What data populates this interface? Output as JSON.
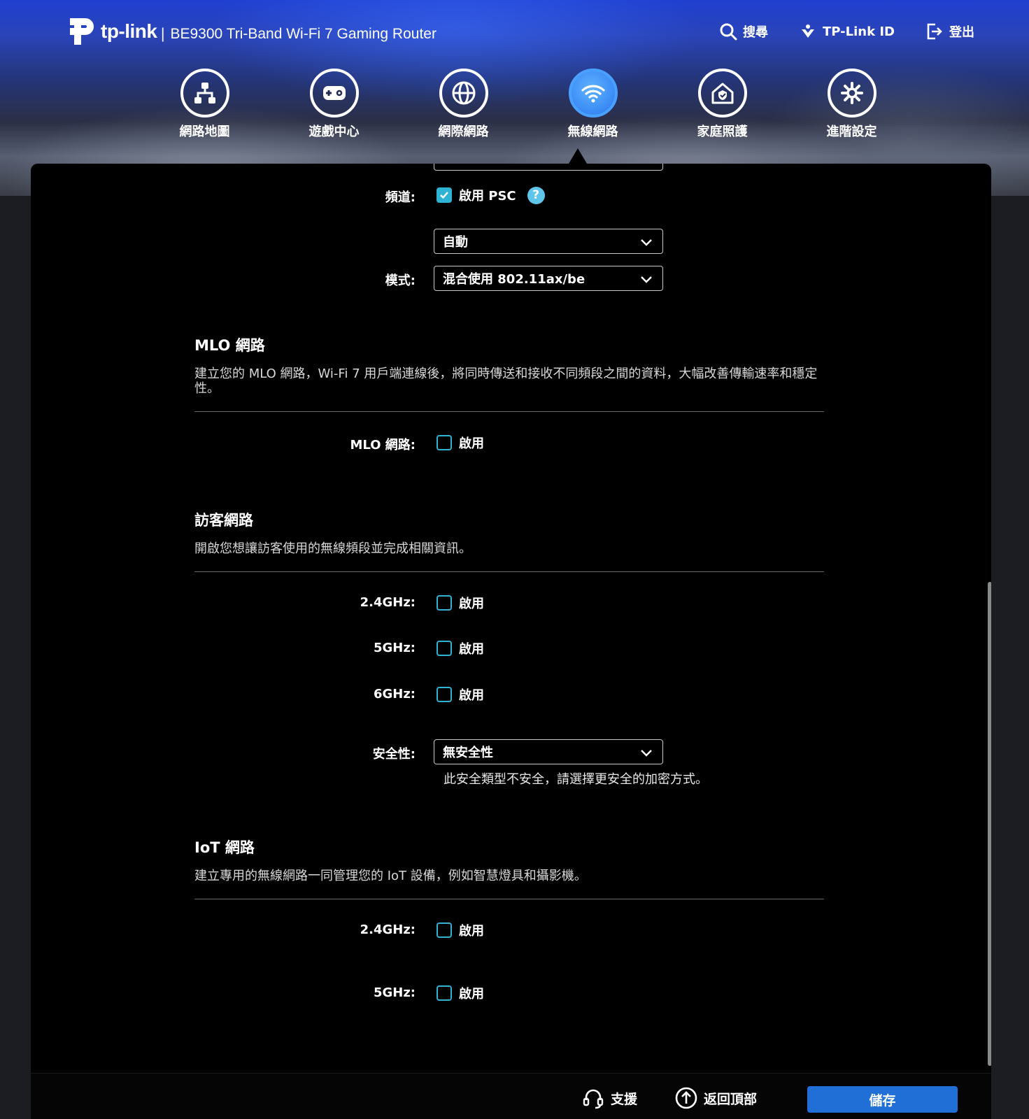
{
  "header": {
    "brand": "tp-link",
    "product": "BE9300 Tri-Band Wi-Fi 7 Gaming Router",
    "separator": "|",
    "links": [
      {
        "label": "搜尋",
        "icon": "search-icon"
      },
      {
        "label": "TP-Link ID",
        "icon": "tplink-id-icon"
      },
      {
        "label": "登出",
        "icon": "logout-icon"
      }
    ]
  },
  "nav": [
    {
      "label": "網路地圖",
      "icon": "network-map-icon"
    },
    {
      "label": "遊戲中心",
      "icon": "gamepad-icon"
    },
    {
      "label": "網際網路",
      "icon": "globe-icon"
    },
    {
      "label": "無線網路",
      "icon": "wifi-icon",
      "active": true
    },
    {
      "label": "家庭照護",
      "icon": "home-care-icon"
    },
    {
      "label": "進階設定",
      "icon": "gear-icon"
    }
  ],
  "wireless": {
    "channel_label": "頻道:",
    "psc_label": "啟用 PSC",
    "psc_checked": true,
    "channel_value": "自動",
    "mode_label": "模式:",
    "mode_value": "混合使用 802.11ax/be"
  },
  "mlo": {
    "title": "MLO 網路",
    "desc": "建立您的 MLO 網路，Wi-Fi 7 用戶端連線後，將同時傳送和接收不同頻段之間的資料，大幅改善傳輸速率和穩定性。",
    "field_label": "MLO 網路:",
    "enable_label": "啟用",
    "checked": false
  },
  "guest": {
    "title": "訪客網路",
    "desc": "開啟您想讓訪客使用的無線頻段並完成相關資訊。",
    "bands": [
      {
        "label": "2.4GHz:",
        "enable": "啟用",
        "checked": false
      },
      {
        "label": "5GHz:",
        "enable": "啟用",
        "checked": false
      },
      {
        "label": "6GHz:",
        "enable": "啟用",
        "checked": false
      }
    ],
    "security_label": "安全性:",
    "security_value": "無安全性",
    "security_note": "此安全類型不安全，請選擇更安全的加密方式。"
  },
  "iot": {
    "title": "IoT 網路",
    "desc": "建立專用的無線網路一同管理您的 IoT 設備，例如智慧燈具和攝影機。",
    "bands": [
      {
        "label": "2.4GHz:",
        "enable": "啟用",
        "checked": false
      },
      {
        "label": "5GHz:",
        "enable": "啟用",
        "checked": false
      }
    ]
  },
  "footer": {
    "support": "支援",
    "back_to_top": "返回頂部",
    "save": "儲存"
  },
  "colors": {
    "accent": "#2fb3d4",
    "save_button": "#1f6fd6",
    "active_nav": "#3a8ff5",
    "panel": "#000000"
  }
}
